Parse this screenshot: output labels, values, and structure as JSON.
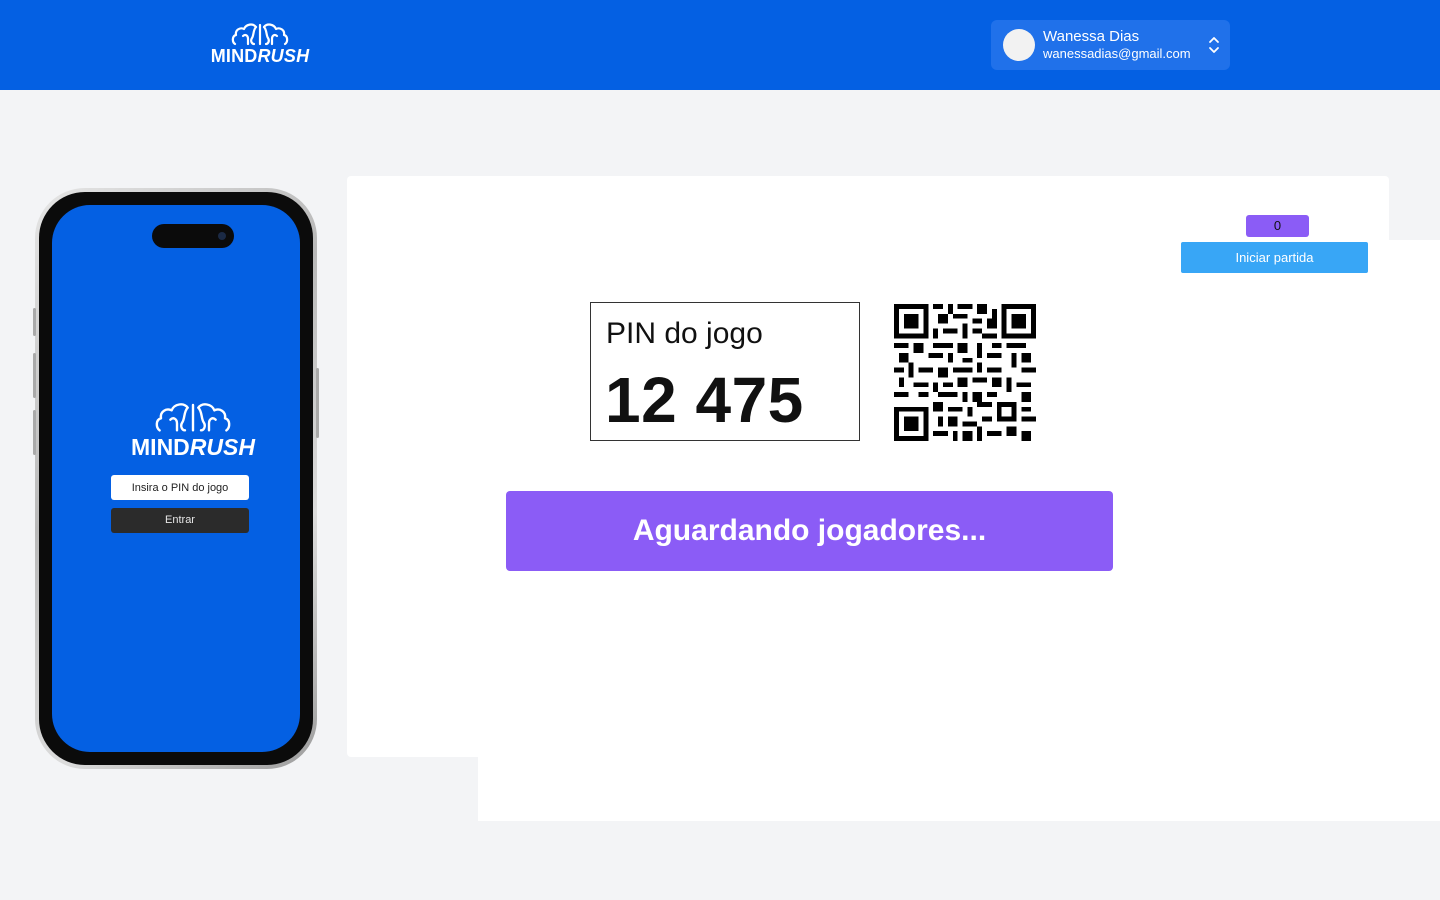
{
  "header": {
    "logo_text": "MINDRUSH",
    "logo_text_regular": "MIND",
    "logo_text_italic": "RUSH",
    "brand_color": "#0460e3",
    "user": {
      "name": "Wanessa Dias",
      "email": "wanessadias@gmail.com",
      "menu_icon": "chevron-up-down-icon"
    }
  },
  "phone_preview": {
    "logo_text_regular": "MIND",
    "logo_text_italic": "RUSH",
    "pin_placeholder": "Insira o PIN do jogo",
    "enter_label": "Entrar"
  },
  "lobby": {
    "player_count": "0",
    "start_label": "Iniciar partida",
    "pin_label": "PIN do jogo",
    "pin_value": "12 475",
    "qr_icon": "qr-code-icon",
    "status_text": "Aguardando jogadores...",
    "accent_color": "#8b5cf6",
    "start_color": "#38a6f6"
  }
}
